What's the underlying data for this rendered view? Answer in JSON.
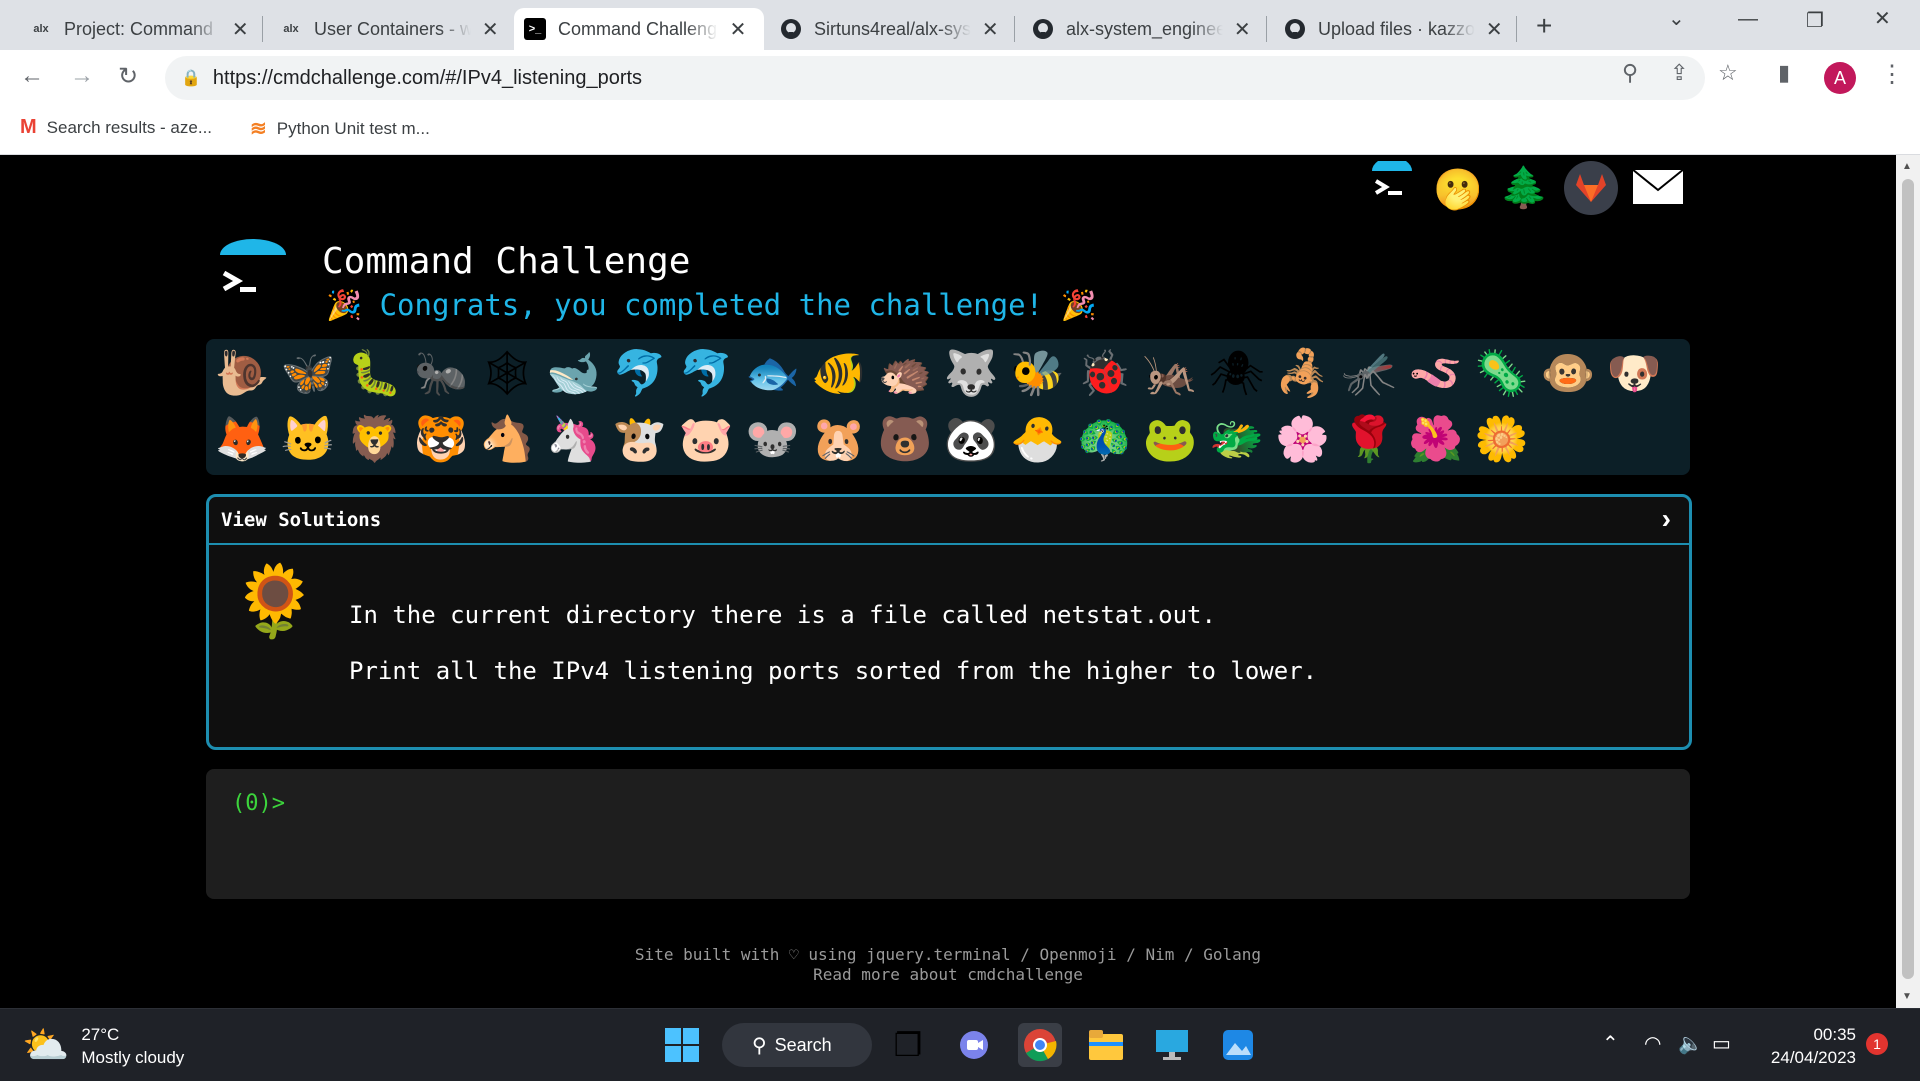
{
  "browser": {
    "tabs": [
      {
        "label": "Project: Command",
        "favicon": "alx"
      },
      {
        "label": "User Containers - w",
        "favicon": "alx"
      },
      {
        "label": "Command Challeng",
        "favicon": ">_"
      },
      {
        "label": "Sirtuns4real/alx-sys",
        "favicon": "github"
      },
      {
        "label": "alx-system_enginee",
        "favicon": "github"
      },
      {
        "label": "Upload files · kazzo",
        "favicon": "github"
      }
    ],
    "url": "https://cmdchallenge.com/#/IPv4_listening_ports",
    "avatar_letter": "A",
    "bookmarks": [
      {
        "label": "Search results - aze...",
        "icon": "gmail-icon"
      },
      {
        "label": "Python Unit test m...",
        "icon": "stack-overflow-icon"
      }
    ]
  },
  "page": {
    "title": "Command Challenge",
    "congrats": "Congrats, you completed the challenge!",
    "top_icons": [
      "terminal-logo",
      "hand-over-mouth-face",
      "evergreen-tree",
      "gitlab",
      "mail"
    ],
    "emojis_row1": [
      "🐌",
      "🦋",
      "🐛",
      "🐜",
      "🕸",
      "🐋",
      "🐬",
      "🐬",
      "🐟",
      "🐠",
      "🦔",
      "🐺",
      "🐝",
      "🐞",
      "🦗",
      "🕷",
      "🦂",
      "🦟",
      "🪱",
      "🦠",
      "🐵",
      "🐶"
    ],
    "emojis_row2": [
      "🦊",
      "🐱",
      "🦁",
      "🐯",
      "🐴",
      "🦄",
      "🐮",
      "🐷",
      "🐭",
      "🐹",
      "🐻",
      "🐼",
      "🐣",
      "🦚",
      "🐸",
      "🐲",
      "🌸",
      "🌹",
      "🌺",
      "🌼"
    ],
    "solutions_label": "View Solutions",
    "challenge_line1": "In the current directory there is a file called netstat.out.",
    "challenge_line2": "Print all the IPv4 listening ports sorted from the higher to lower.",
    "prompt": "(0)>",
    "footer_line1": "Site built with ♡ using jquery.terminal / Openmoji / Nim / Golang",
    "footer_line2": "Read more about cmdchallenge"
  },
  "taskbar": {
    "temperature": "27°C",
    "weather": "Mostly cloudy",
    "search_label": "Search",
    "time": "00:35",
    "date": "24/04/2023",
    "notification_count": "1"
  },
  "colors": {
    "accent_cyan": "#1fb6e8",
    "prompt_green": "#3cd43c",
    "box_border": "#1d8eb0"
  }
}
